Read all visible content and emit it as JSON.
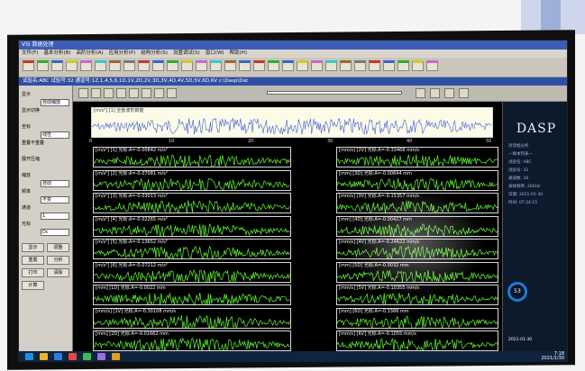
{
  "app": {
    "title": "VSI 数据处理",
    "menu": [
      "文件(F)",
      "基本分析(B)",
      "高阶分析(A)",
      "应用分析(P)",
      "结构分析(S)",
      "设置调试(S)",
      "窗口(W)",
      "帮助(H)"
    ],
    "info_bar": "试验名:ABC  试验号:32  通道号:1Z,1,4,5,6,1D,1V,2D,2V,3D,3V,4D,4V,5D,5V,6D,6V  c:\\Dasp\\Dat",
    "dasp_logo": "DASP"
  },
  "left_panel": {
    "rows": [
      {
        "label": "显示",
        "value": "自动缩放"
      },
      {
        "label": "显示切换",
        "value": ""
      },
      {
        "label": "坐标",
        "value": "线性"
      },
      {
        "label": "重叠不重叠",
        "value": ""
      },
      {
        "label": "展开压缩",
        "value": ""
      },
      {
        "label": "缩放",
        "value": "自动"
      },
      {
        "label": "频率",
        "value": "不变"
      },
      {
        "label": "通道",
        "value": "1"
      },
      {
        "label": "光标",
        "value": "Dc"
      }
    ],
    "buttons": [
      "显示",
      "调整",
      "重置",
      "分析",
      "打印",
      "清除",
      "计算"
    ]
  },
  "top_channel": {
    "label": "[m/s²] [1] 全部波形数据",
    "ticks": [
      "0",
      "10",
      "20",
      "30",
      "40",
      "50"
    ]
  },
  "channels_left": [
    {
      "label": "[m/s²] [1] 光标:A=-0.00842 m/s²"
    },
    {
      "label": "[m/s²] [2] 光标:A=-0.07081 m/s²"
    },
    {
      "label": "[m/s²] [3] 光标:A=-0.03013 m/s²"
    },
    {
      "label": "[m/s²] [4] 光标:A=-0.02265 m/s²"
    },
    {
      "label": "[m/s²] [5] 光标:A=-0.13652 m/s²"
    },
    {
      "label": "[m/s²] [6] 光标:A=-0.07212 m/s²"
    },
    {
      "label": "[mm] [1D] 光标:A=-0.0022 mm"
    },
    {
      "label": "[mm/s] [1V] 光标:A=-0.30108 mm/s"
    },
    {
      "label": "[mm] [2D] 光标:A=-0.01662 mm"
    }
  ],
  "channels_right": [
    {
      "label": "[mm/s] [2V] 光标:A=-0.33468 mm/s"
    },
    {
      "label": "[mm] [3D] 光标:A=-0.00644 mm"
    },
    {
      "label": "[mm/s] [3V] 光标:A=-0.15357 mm/s"
    },
    {
      "label": "[mm] [4D] 光标:A=-0.00427 mm"
    },
    {
      "label": "[mm/s] [4V] 光标:A=-0.24622 mm/s"
    },
    {
      "label": "[mm] [5D] 光标:A=-0.0032 mm"
    },
    {
      "label": "[mm/s] [5V] 光标:A=-0.10355 mm/s"
    },
    {
      "label": "[mm] [6D] 光标:A=-0.3366 mm"
    },
    {
      "label": "[mm/s] [6V] 光标:A=-0.1055 mm/s"
    }
  ],
  "bottom_axis": [
    "0",
    "10",
    "20",
    "30",
    "40",
    "50",
    "60",
    "(s)"
  ],
  "side_panel": {
    "lines": [
      "对话框分析",
      "—样本列表—",
      "试验名: ABC",
      "试验号: 32",
      "通道数: 18",
      "采样频率: 200Hz",
      "日期: 2021-01-30",
      "时间: 07:24:15"
    ],
    "gauge": "53",
    "date": "2021-01-30"
  },
  "taskbar": {
    "time": "7:18",
    "date": "2021/1/30"
  }
}
